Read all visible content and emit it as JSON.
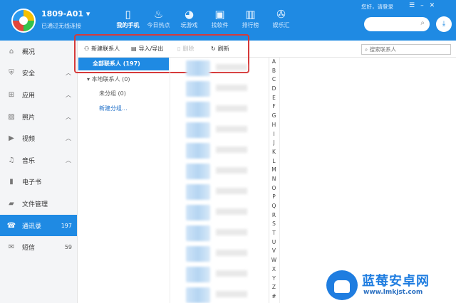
{
  "app": {
    "device_name": "1809-A01",
    "device_status": "已通过无线连接",
    "login_text": "您好，请登录",
    "search_placeholder": ""
  },
  "nav": [
    {
      "label": "我的手机",
      "icon": "phone-icon",
      "active": true
    },
    {
      "label": "今日热点",
      "icon": "flame-icon",
      "active": false
    },
    {
      "label": "玩游戏",
      "icon": "game-icon",
      "active": false
    },
    {
      "label": "找软件",
      "icon": "app-icon",
      "active": false
    },
    {
      "label": "排行榜",
      "icon": "ranking-icon",
      "active": false
    },
    {
      "label": "娱乐汇",
      "icon": "film-icon",
      "active": false
    }
  ],
  "sidebar": [
    {
      "label": "概况",
      "icon": "home-icon",
      "caret": "",
      "count": ""
    },
    {
      "label": "安全",
      "icon": "shield-icon",
      "caret": "^",
      "count": ""
    },
    {
      "label": "应用",
      "icon": "apps-icon",
      "caret": "^",
      "count": ""
    },
    {
      "label": "照片",
      "icon": "photo-icon",
      "caret": "^",
      "count": ""
    },
    {
      "label": "视频",
      "icon": "video-icon",
      "caret": "^",
      "count": ""
    },
    {
      "label": "音乐",
      "icon": "music-icon",
      "caret": "^",
      "count": ""
    },
    {
      "label": "电子书",
      "icon": "book-icon",
      "caret": "",
      "count": ""
    },
    {
      "label": "文件管理",
      "icon": "folder-icon",
      "caret": "",
      "count": ""
    },
    {
      "label": "通讯录",
      "icon": "contacts-icon",
      "caret": "",
      "count": "197",
      "active": true
    },
    {
      "label": "短信",
      "icon": "sms-icon",
      "caret": "",
      "count": "59"
    }
  ],
  "toolbar": {
    "new_contact": "新建联系人",
    "import_export": "导入/导出",
    "delete": "删除",
    "refresh": "刷新",
    "search_placeholder": "搜索联系人"
  },
  "groups": {
    "all": "全部联系人 (197)",
    "local": "本地联系人 (0)",
    "ungrouped": "未分组 (0)",
    "new_group": "新建分组..."
  },
  "alphabet": [
    "A",
    "B",
    "C",
    "D",
    "E",
    "F",
    "G",
    "H",
    "I",
    "J",
    "K",
    "L",
    "M",
    "N",
    "O",
    "P",
    "Q",
    "R",
    "S",
    "T",
    "U",
    "V",
    "W",
    "X",
    "Y",
    "Z",
    "#"
  ],
  "watermark": {
    "title": "蓝莓安卓网",
    "url": "www.lmkjst.com"
  },
  "colors": {
    "accent": "#1f8ae3",
    "highlight_box": "#d63a3a"
  }
}
